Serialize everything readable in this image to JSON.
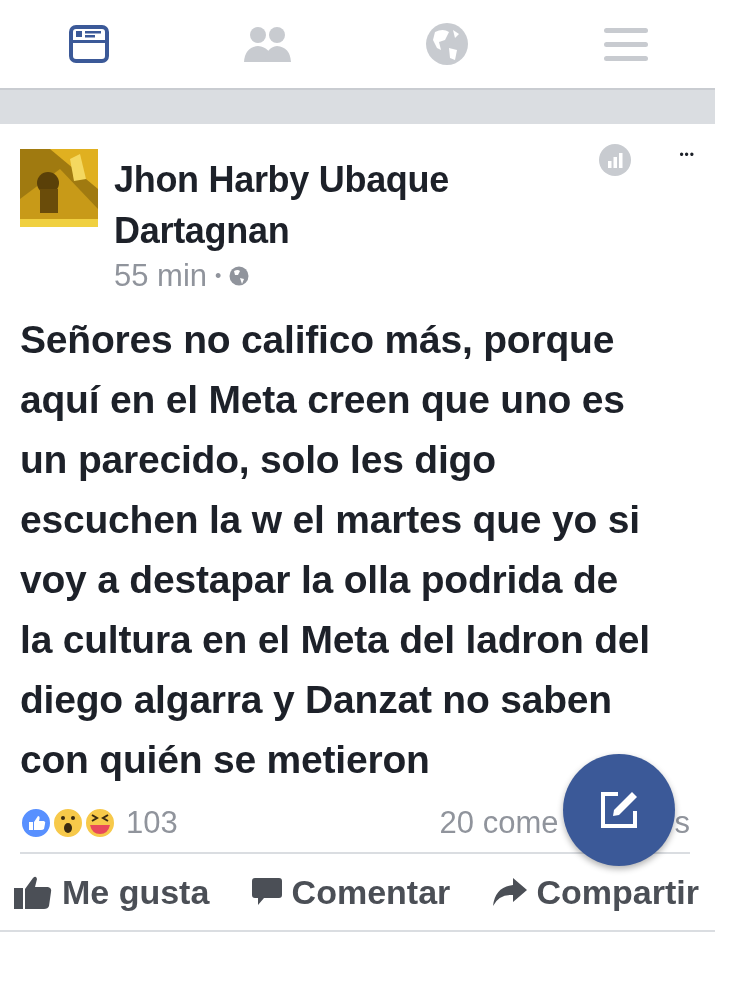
{
  "nav_tabs": [
    {
      "kind": "news",
      "selected": true
    },
    {
      "kind": "friends",
      "selected": false
    },
    {
      "kind": "globe",
      "selected": false
    },
    {
      "kind": "menu",
      "selected": false
    }
  ],
  "post": {
    "author": "Jhon Harby Ubaque Dartagnan",
    "time": "55 min",
    "separator": "•",
    "text": "Señores no califico más, porque aquí en el Meta creen que uno es un parecido, solo les digo escuchen la w el martes que yo si voy a destapar la olla podrida de la cultura en el Meta del ladron del diego algarra y Danzat no saben con quién se metieron",
    "more": "•••",
    "reaction_count": "103",
    "comments_before": "20 come",
    "comments_after": "s",
    "actions": [
      {
        "kind": "like",
        "label": "Me gusta"
      },
      {
        "kind": "comment",
        "label": "Comentar"
      },
      {
        "kind": "share",
        "label": "Compartir"
      }
    ]
  }
}
